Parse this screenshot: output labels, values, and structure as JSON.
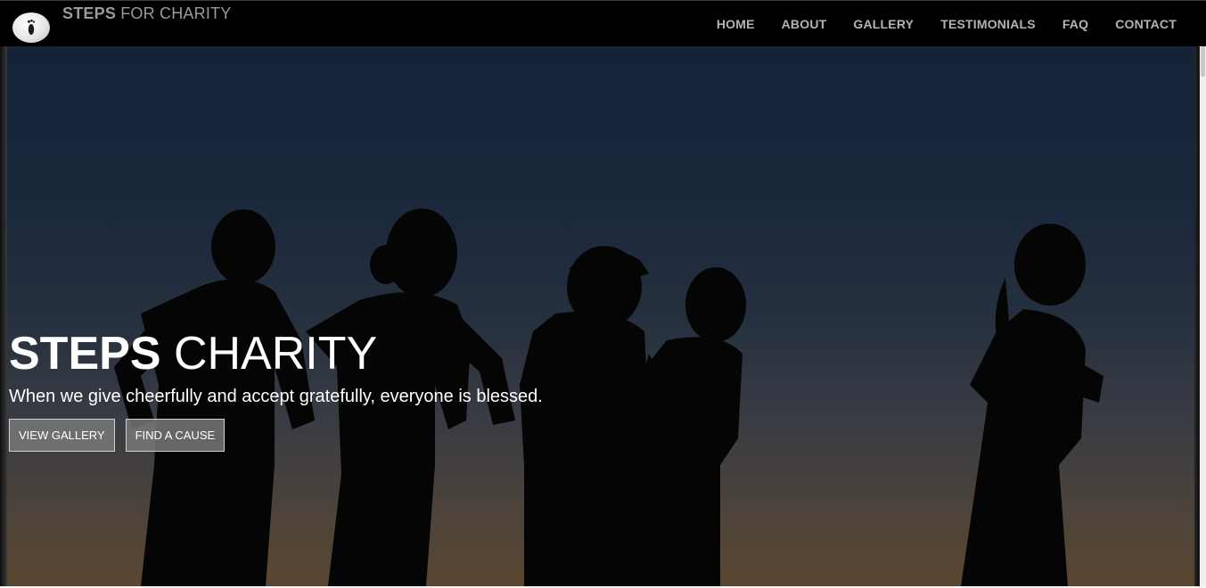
{
  "brand": {
    "name_bold": "STEPS",
    "name_rest": "FOR CHARITY",
    "logo_icon": "footprint-icon"
  },
  "nav": {
    "items": [
      {
        "label": "HOME"
      },
      {
        "label": "ABOUT"
      },
      {
        "label": "GALLERY"
      },
      {
        "label": "TESTIMONIALS"
      },
      {
        "label": "FAQ"
      },
      {
        "label": "CONTACT"
      }
    ]
  },
  "hero": {
    "title_bold": "STEPS",
    "title_rest": "CHARITY",
    "tagline": "When we give cheerfully and accept gratefully, everyone is blessed.",
    "buttons": {
      "view_gallery": "VIEW GALLERY",
      "find_cause": "FIND A CAUSE"
    }
  },
  "colors": {
    "navbar_bg": "#000000",
    "nav_text": "#b3b3b3",
    "brand_text": "#9a9a9a",
    "hero_text": "#ffffff",
    "button_bg": "#787878"
  }
}
